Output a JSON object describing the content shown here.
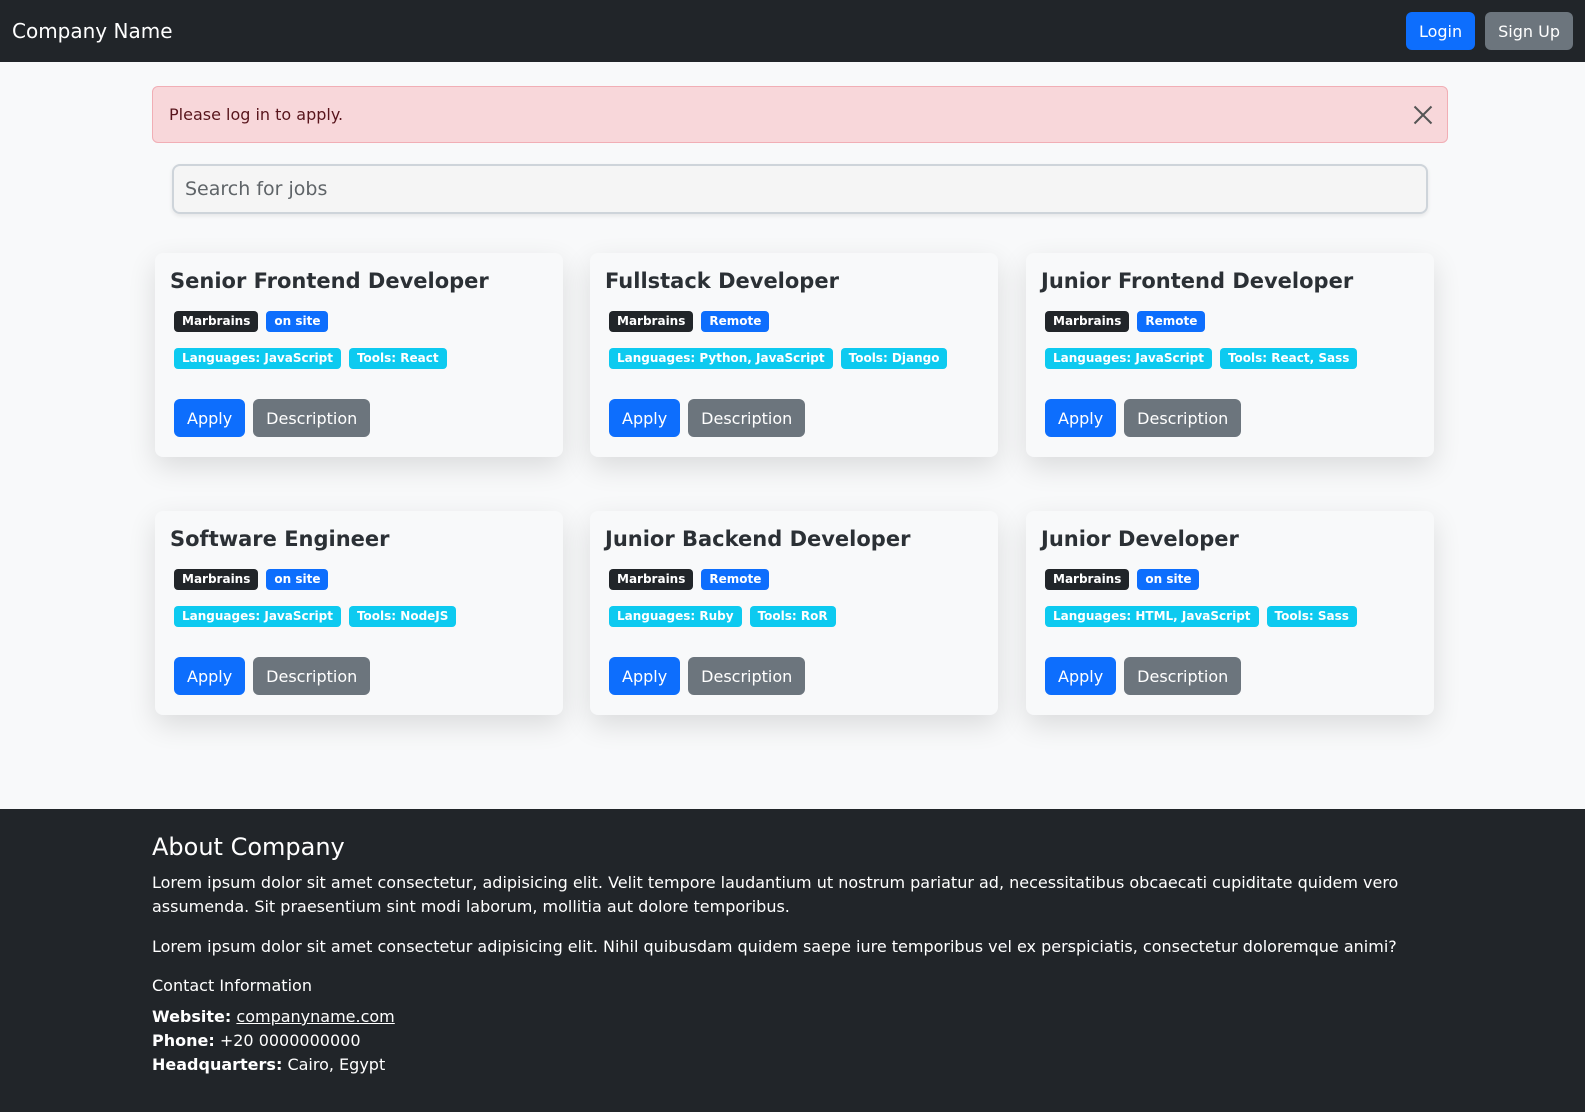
{
  "navbar": {
    "brand": "Company Name",
    "login_label": "Login",
    "signup_label": "Sign Up"
  },
  "alert": {
    "message": "Please log in to apply."
  },
  "search": {
    "placeholder": "Search for jobs"
  },
  "jobs": [
    {
      "title": "Senior Frontend Developer",
      "company": "Marbrains",
      "location": "on site",
      "languages": "Languages: JavaScript",
      "tools": "Tools: React",
      "apply": "Apply",
      "description": "Description"
    },
    {
      "title": "Fullstack Developer",
      "company": "Marbrains",
      "location": "Remote",
      "languages": "Languages: Python, JavaScript",
      "tools": "Tools: Django",
      "apply": "Apply",
      "description": "Description"
    },
    {
      "title": "Junior Frontend Developer",
      "company": "Marbrains",
      "location": "Remote",
      "languages": "Languages: JavaScript",
      "tools": "Tools: React, Sass",
      "apply": "Apply",
      "description": "Description"
    },
    {
      "title": "Software Engineer",
      "company": "Marbrains",
      "location": "on site",
      "languages": "Languages: JavaScript",
      "tools": "Tools: NodeJS",
      "apply": "Apply",
      "description": "Description"
    },
    {
      "title": "Junior Backend Developer",
      "company": "Marbrains",
      "location": "Remote",
      "languages": "Languages: Ruby",
      "tools": "Tools: RoR",
      "apply": "Apply",
      "description": "Description"
    },
    {
      "title": "Junior Developer",
      "company": "Marbrains",
      "location": "on site",
      "languages": "Languages: HTML, JavaScript",
      "tools": "Tools: Sass",
      "apply": "Apply",
      "description": "Description"
    }
  ],
  "footer": {
    "heading": "About Company",
    "paragraph1": "Lorem ipsum dolor sit amet consectetur, adipisicing elit. Velit tempore laudantium ut nostrum pariatur ad, necessitatibus obcaecati cupiditate quidem vero assumenda. Sit praesentium sint modi laborum, mollitia aut dolore temporibus.",
    "paragraph2": "Lorem ipsum dolor sit amet consectetur adipisicing elit. Nihil quibusdam quidem saepe iure temporibus vel ex perspiciatis, consectetur doloremque animi?",
    "contact_heading": "Contact Information",
    "website_label": "Website:",
    "website_value": "companyname.com",
    "phone_label": "Phone:",
    "phone_value": "+20 0000000000",
    "hq_label": "Headquarters:",
    "hq_value": "Cairo, Egypt"
  },
  "colors": {
    "primary": "#0d6efd",
    "secondary": "#6c757d",
    "dark": "#212529",
    "info": "#0dcaf0",
    "alert_bg": "#f8d7da"
  }
}
